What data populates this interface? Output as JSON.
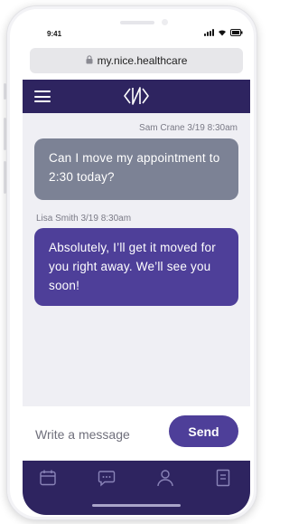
{
  "status_bar": {
    "time": "9:41"
  },
  "browser": {
    "url": "my.nice.healthcare"
  },
  "header": {
    "menu_icon": "hamburger-menu-icon",
    "logo_icon": "nice-healthcare-logo"
  },
  "messages": [
    {
      "sender": "Sam Crane",
      "timestamp": "3/19 8:30am",
      "meta": "Sam Crane 3/19 8:30am",
      "text": "Can I move my appointment to 2:30 today?",
      "align": "right"
    },
    {
      "sender": "Lisa Smith",
      "timestamp": "3/19 8:30am",
      "meta": "Lisa Smith 3/19 8:30am",
      "text": "Absolutely, I’ll get it moved for you right away. We’ll see you soon!",
      "align": "left"
    }
  ],
  "composer": {
    "placeholder": "Write a message",
    "send_label": "Send"
  },
  "tab_bar": {
    "items": [
      {
        "icon": "calendar-icon"
      },
      {
        "icon": "chat-icon"
      },
      {
        "icon": "profile-icon"
      },
      {
        "icon": "document-icon"
      }
    ]
  },
  "colors": {
    "brand_dark": "#2e2460",
    "brand_purple": "#4e3f99",
    "sent_bubble": "#7c8295",
    "chat_background": "#efeff4"
  }
}
